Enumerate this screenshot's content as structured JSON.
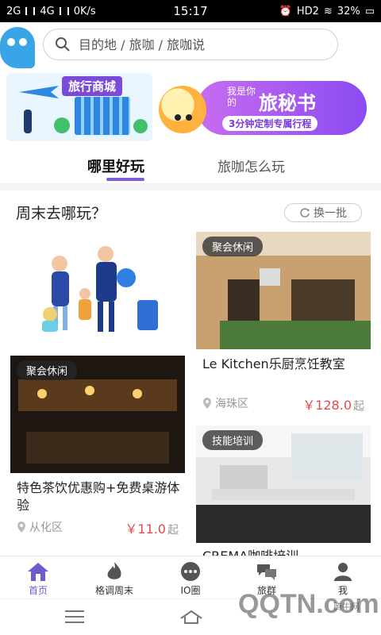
{
  "status_bar": {
    "network": "2G",
    "network2": "4G",
    "speed": "0K/s",
    "time": "15:17",
    "hd": "HD2",
    "battery": "32%"
  },
  "header": {
    "search_placeholder": "目的地 / 旅咖 / 旅咖说"
  },
  "banners": {
    "mall_label": "旅行商城",
    "secretary_line1": "我是你的",
    "secretary_line2": "旅秘书",
    "secretary_sub": "3分钟定制专属行程"
  },
  "tabs": [
    {
      "label": "哪里好玩",
      "active": true
    },
    {
      "label": "旅咖怎么玩",
      "active": false
    }
  ],
  "section": {
    "title": "周末去哪玩？",
    "refresh_label": "换一批"
  },
  "cards": [
    {
      "badge": "聚会休闲",
      "title": "Le Kitchen乐厨烹饪教室",
      "location": "海珠区",
      "price": "￥128.0",
      "price_unit": "起"
    },
    {
      "badge": "聚会休闲",
      "title": "特色茶饮优惠购+免费桌游体验",
      "location": "从化区",
      "price": "￥11.0",
      "price_unit": "起"
    },
    {
      "badge": "技能培训",
      "title": "CREMA咖啡培训"
    }
  ],
  "bottom_nav": [
    {
      "label": "首页",
      "icon": "home-icon",
      "active": true
    },
    {
      "label": "格调周末",
      "icon": "flame-icon",
      "active": false
    },
    {
      "label": "IO圈",
      "icon": "chat-dots-icon",
      "active": false
    },
    {
      "label": "旅群",
      "icon": "group-chat-icon",
      "active": false
    },
    {
      "label": "我",
      "icon": "person-icon",
      "active": false
    }
  ],
  "watermark": {
    "text": "QQTN.com",
    "small": "腾牛网"
  },
  "colors": {
    "accent": "#6f5ad0",
    "price": "#e24a4a"
  }
}
